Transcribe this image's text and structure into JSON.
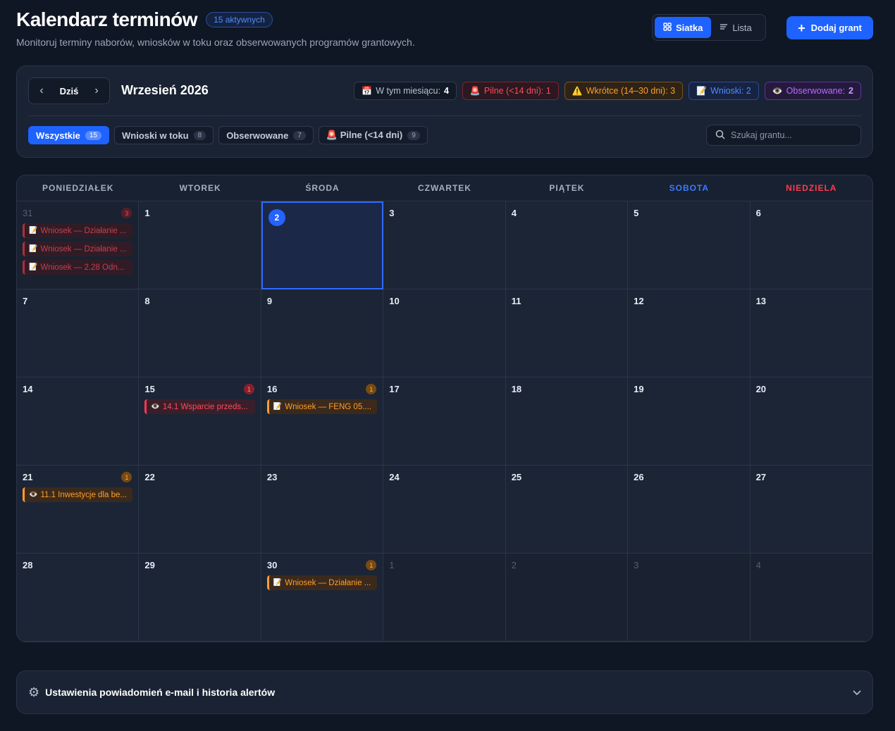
{
  "header": {
    "title": "Kalendarz terminów",
    "active_badge": "15 aktywnych",
    "subtitle": "Monitoruj terminy naborów, wniosków w toku oraz obserwowanych programów grantowych.",
    "view_grid": "Siatka",
    "view_list": "Lista",
    "add_button": "Dodaj grant"
  },
  "toolbar": {
    "today": "Dziś",
    "month": "Wrzesień 2026",
    "stats": [
      {
        "icon": "📅",
        "label": "W tym miesiącu:",
        "value": "4",
        "kind": "month"
      },
      {
        "icon": "🚨",
        "label": "Pilne (<14 dni): 1",
        "kind": "urgent"
      },
      {
        "icon": "⚠️",
        "label": "Wkrótce (14–30 dni): 3",
        "kind": "soon"
      },
      {
        "icon": "📝",
        "label": "Wnioski: 2",
        "kind": "apps"
      },
      {
        "icon": "👁️",
        "label": "Obserwowane:",
        "value": "2",
        "kind": "watch"
      }
    ],
    "filters": [
      {
        "label": "Wszystkie",
        "count": "15",
        "active": true
      },
      {
        "label": "Wnioski w toku",
        "count": "8"
      },
      {
        "label": "Obserwowane",
        "count": "7"
      },
      {
        "label": "🚨 Pilne (<14 dni)",
        "count": "9"
      }
    ],
    "search_placeholder": "Szukaj grantu..."
  },
  "calendar": {
    "weekdays": [
      "PONIEDZIAŁEK",
      "WTOREK",
      "ŚRODA",
      "CZWARTEK",
      "PIĄTEK",
      "SOBOTA",
      "NIEDZIELA"
    ],
    "days": [
      {
        "n": "31",
        "outside": true,
        "count": "3",
        "badge": "red",
        "events": [
          {
            "icon": "📝",
            "text": "Wniosek — Działanie ...",
            "color": "red"
          },
          {
            "icon": "📝",
            "text": "Wniosek — Działanie ...",
            "color": "red"
          },
          {
            "icon": "📝",
            "text": "Wniosek — 2.28 Odn...",
            "color": "red"
          }
        ]
      },
      {
        "n": "1"
      },
      {
        "n": "2",
        "today": true
      },
      {
        "n": "3"
      },
      {
        "n": "4"
      },
      {
        "n": "5"
      },
      {
        "n": "6"
      },
      {
        "n": "7"
      },
      {
        "n": "8"
      },
      {
        "n": "9"
      },
      {
        "n": "10"
      },
      {
        "n": "11"
      },
      {
        "n": "12"
      },
      {
        "n": "13"
      },
      {
        "n": "14"
      },
      {
        "n": "15",
        "count": "1",
        "badge": "red",
        "events": [
          {
            "icon": "👁️",
            "text": "14.1 Wsparcie przeds...",
            "color": "red"
          }
        ]
      },
      {
        "n": "16",
        "count": "1",
        "badge": "orange",
        "events": [
          {
            "icon": "📝",
            "text": "Wniosek — FENG 05....",
            "color": "orange"
          }
        ]
      },
      {
        "n": "17"
      },
      {
        "n": "18"
      },
      {
        "n": "19"
      },
      {
        "n": "20"
      },
      {
        "n": "21",
        "count": "1",
        "badge": "orange",
        "events": [
          {
            "icon": "👁️",
            "text": "11.1 Inwestycje dla be...",
            "color": "orange"
          }
        ]
      },
      {
        "n": "22"
      },
      {
        "n": "23"
      },
      {
        "n": "24"
      },
      {
        "n": "25"
      },
      {
        "n": "26"
      },
      {
        "n": "27"
      },
      {
        "n": "28"
      },
      {
        "n": "29"
      },
      {
        "n": "30",
        "count": "1",
        "badge": "orange",
        "events": [
          {
            "icon": "📝",
            "text": "Wniosek — Działanie ...",
            "color": "orange"
          }
        ]
      },
      {
        "n": "1",
        "outside": true
      },
      {
        "n": "2",
        "outside": true
      },
      {
        "n": "3",
        "outside": true
      },
      {
        "n": "4",
        "outside": true
      }
    ]
  },
  "settings": {
    "label": "Ustawienia powiadomień e-mail i historia alertów"
  }
}
